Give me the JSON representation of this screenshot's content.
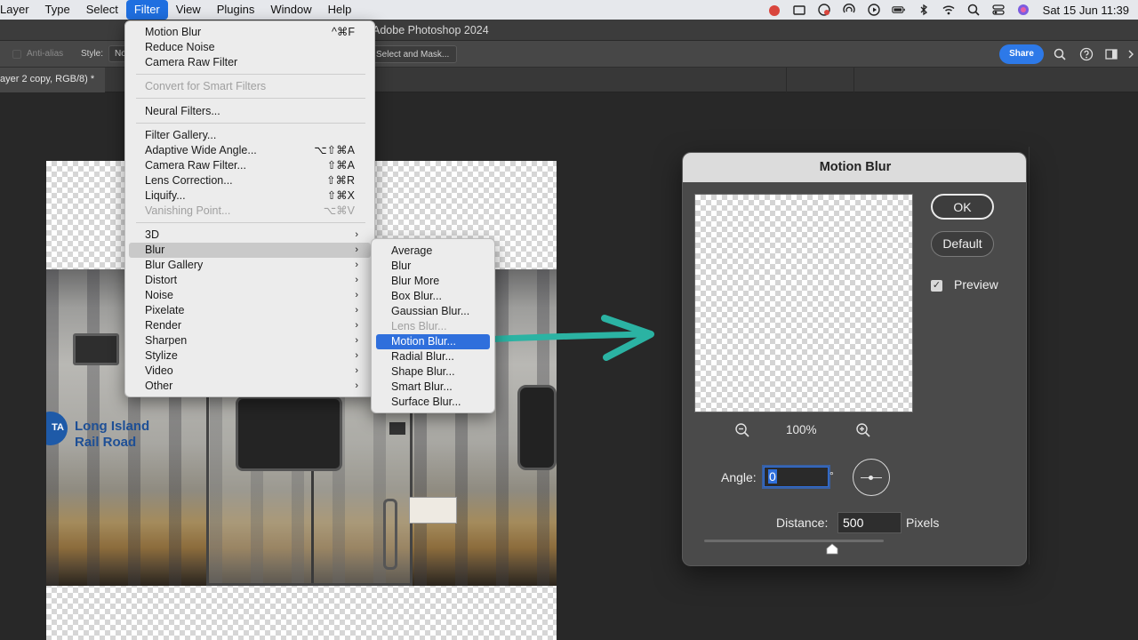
{
  "menubar": {
    "items": [
      "Layer",
      "Type",
      "Select",
      "Filter",
      "View",
      "Plugins",
      "Window",
      "Help"
    ],
    "active_item": "Filter",
    "status_icons": [
      "battery-icon",
      "bluetooth-icon",
      "wifi-icon",
      "search-icon",
      "control-center-icon",
      "siri-icon"
    ],
    "clock": "Sat 15 Jun  11:39"
  },
  "window": {
    "title": "Adobe Photoshop 2024"
  },
  "options_bar": {
    "anti_alias": "Anti-alias",
    "style_label": "Style:",
    "style_value": "No",
    "select_and_mask": "Select and Mask...",
    "share_label": "Share"
  },
  "doc_tab": {
    "title": "ayer 2 copy, RGB/8) *"
  },
  "canvas": {
    "lirr_text": "Long Island\nRail Road",
    "badge_text": "TA"
  },
  "filter_menu": {
    "motion_blur": {
      "label": "Motion Blur",
      "shortcut": "^⌘F"
    },
    "reduce_noise": "Reduce Noise",
    "camera_raw": "Camera Raw Filter",
    "convert_smart": "Convert for Smart Filters",
    "neural": "Neural Filters...",
    "filter_gallery": "Filter Gallery...",
    "adaptive": {
      "label": "Adaptive Wide Angle...",
      "shortcut": "⌥⇧⌘A"
    },
    "camera_raw_filter": {
      "label": "Camera Raw Filter...",
      "shortcut": "⇧⌘A"
    },
    "lens_correction": {
      "label": "Lens Correction...",
      "shortcut": "⇧⌘R"
    },
    "liquify": {
      "label": "Liquify...",
      "shortcut": "⇧⌘X"
    },
    "vanishing": {
      "label": "Vanishing Point...",
      "shortcut": "⌥⌘V"
    },
    "submenus": [
      "3D",
      "Blur",
      "Blur Gallery",
      "Distort",
      "Noise",
      "Pixelate",
      "Render",
      "Sharpen",
      "Stylize",
      "Video",
      "Other"
    ]
  },
  "blur_submenu": {
    "items": [
      "Average",
      "Blur",
      "Blur More",
      "Box Blur...",
      "Gaussian Blur...",
      "Lens Blur...",
      "Motion Blur...",
      "Radial Blur...",
      "Shape Blur...",
      "Smart Blur...",
      "Surface Blur..."
    ]
  },
  "dialog": {
    "title": "Motion Blur",
    "ok_label": "OK",
    "default_label": "Default",
    "preview_label": "Preview",
    "preview_checked": true,
    "zoom_value": "100%",
    "angle_label": "Angle:",
    "angle_value": "0",
    "degree_symbol": "°",
    "distance_label": "Distance:",
    "distance_value": "500",
    "distance_unit": "Pixels"
  },
  "colors": {
    "accent": "#2f6fdc",
    "share": "#2d79e8",
    "arrow": "#2bb3a3"
  }
}
